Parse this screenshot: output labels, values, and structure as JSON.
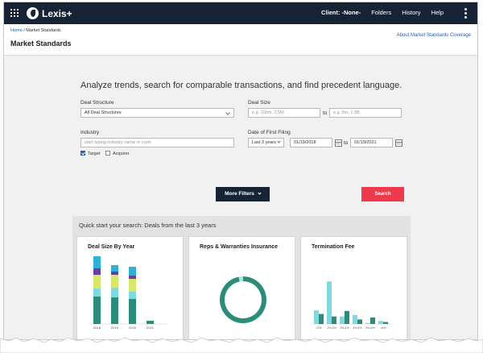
{
  "app": {
    "name": "Lexis+"
  },
  "nav": {
    "client": "Client: -None-",
    "folders": "Folders",
    "history": "History",
    "help": "Help"
  },
  "header": {
    "breadcrumb_home": "Home",
    "breadcrumb_sep": " / ",
    "breadcrumb_current": "Market Standards",
    "title": "Market Standards",
    "about_link": "About Market Standards Coverage"
  },
  "search": {
    "headline": "Analyze trends, search for comparable transactions, and find precedent language.",
    "deal_structure": {
      "label": "Deal Structure",
      "value": "All Deal Structures"
    },
    "deal_size": {
      "label": "Deal Size",
      "min_placeholder": "e.g. 100m, 2.5M",
      "to": "to",
      "max_placeholder": "e.g. 5m, 1.5B"
    },
    "industry": {
      "label": "Industry",
      "placeholder": "start typing industry name or code",
      "target_label": "Target",
      "target_checked": true,
      "acquirer_label": "Acquirer",
      "acquirer_checked": false
    },
    "date": {
      "label": "Date of First Filing",
      "range_value": "Last 3 years",
      "from": "01/19/2018",
      "to": "to",
      "until": "01/19/2021"
    },
    "more_filters_label": "More Filters",
    "search_label": "Search"
  },
  "quick_start": {
    "title": "Quick start your search: Deals from the last 3 years",
    "cards": [
      {
        "title": "Deal Size By Year"
      },
      {
        "title": "Reps & Warranties Insurance"
      },
      {
        "title": "Termination Fee"
      }
    ]
  },
  "colors": {
    "nav_bg": "#152335",
    "search_btn": "#ee3a4c",
    "teal_dark": "#2b8c7a",
    "teal_light": "#7fd9e0",
    "lime": "#d6e86a",
    "sky": "#2fb0d6",
    "purple": "#6a3f9e"
  },
  "chart_data": [
    {
      "type": "bar",
      "title": "Deal Size By Year",
      "categories": [
        "2018",
        "2019",
        "2020",
        "2021"
      ],
      "stacked": true,
      "series_colors": [
        "#2b8c7a",
        "#7fd9e0",
        "#d6e86a",
        "#6a3f9e",
        "#2fb0d6"
      ],
      "series": [
        {
          "values": [
            34,
            33,
            31,
            4
          ]
        },
        {
          "values": [
            10,
            12,
            9,
            0
          ]
        },
        {
          "values": [
            17,
            16,
            16,
            0
          ]
        },
        {
          "values": [
            8,
            4,
            4,
            0
          ]
        },
        {
          "values": [
            15,
            8,
            11,
            0
          ]
        }
      ],
      "ylim": [
        0,
        90
      ]
    },
    {
      "type": "pie",
      "title": "Reps & Warranties Insurance",
      "donut": true,
      "values": [
        97,
        3
      ],
      "colors": [
        "#2b8c7a",
        "#a7e6ea"
      ]
    },
    {
      "type": "bar",
      "title": "Termination Fee",
      "categories": [
        "<2%",
        "2%-3%",
        "3%-4%",
        "4%-5%",
        "5%-6%",
        ">6%"
      ],
      "series_colors": [
        "#7fd9e0",
        "#2b8c7a"
      ],
      "series": [
        {
          "values": [
            27,
            85,
            15,
            18,
            2,
            6
          ]
        },
        {
          "values": [
            20,
            15,
            26,
            9,
            13,
            4
          ]
        }
      ],
      "ylim": [
        0,
        90
      ]
    }
  ]
}
